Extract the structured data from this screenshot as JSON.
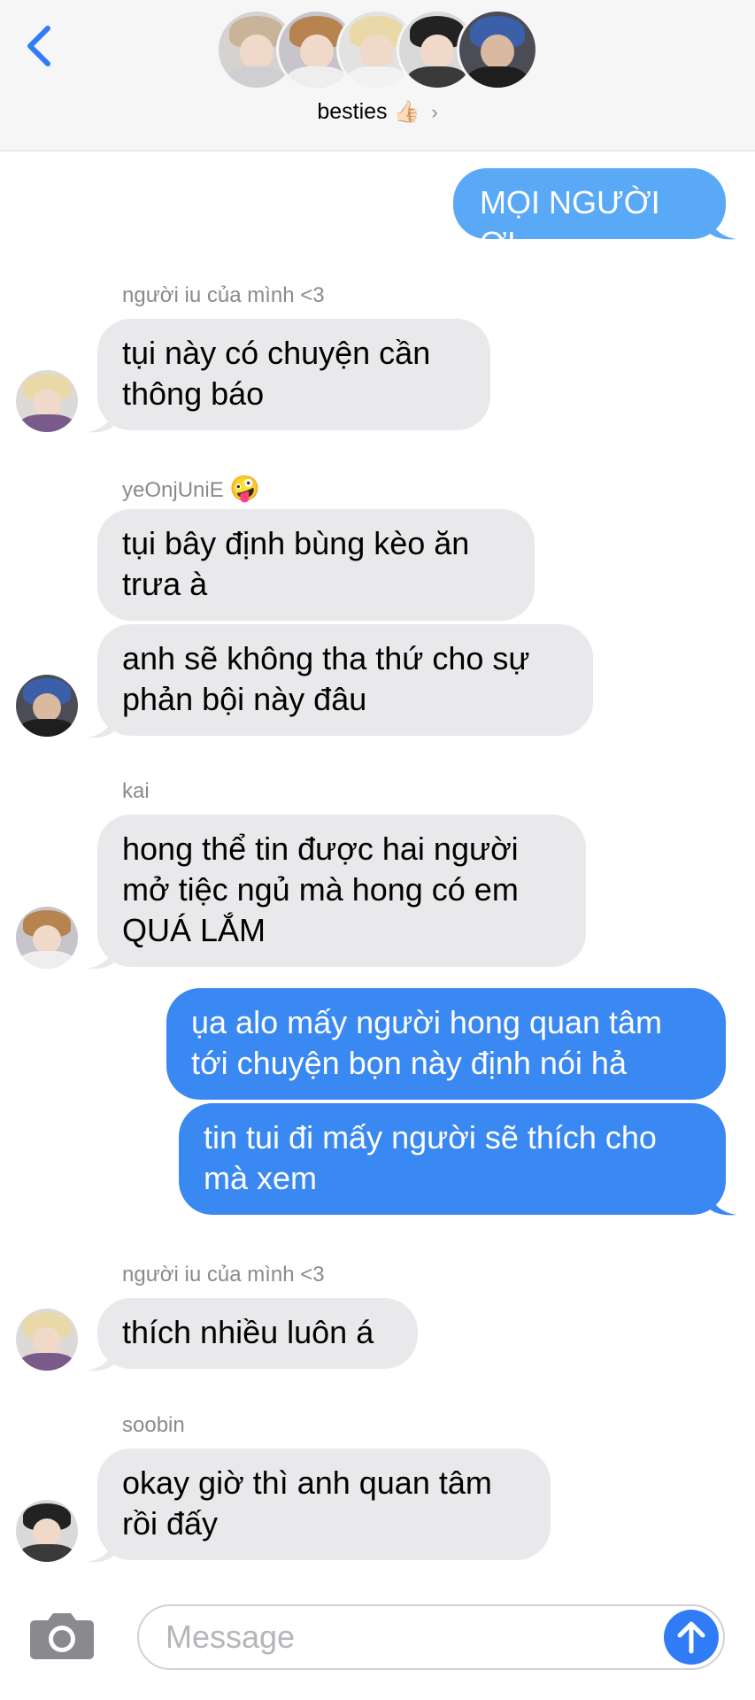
{
  "header": {
    "group_name": "besties",
    "group_emoji": "👍🏻",
    "chevron": "›"
  },
  "messages": [
    {
      "id": "m1",
      "direction": "outgoing",
      "text": "MỌI NGƯỜI ƠI"
    },
    {
      "id": "m2",
      "direction": "incoming",
      "sender": "người iu của mình <3",
      "text": "tụi này có chuyện cần thông báo"
    },
    {
      "id": "m3",
      "direction": "incoming",
      "sender": "yeOnjUniE",
      "sender_emoji": "🤪",
      "text": "tụi bây định bùng kèo ăn trưa à"
    },
    {
      "id": "m4",
      "direction": "incoming",
      "text": "anh sẽ không tha thứ cho sự phản bội này đâu"
    },
    {
      "id": "m5",
      "direction": "incoming",
      "sender": "kai",
      "text": "hong thể tin được hai người mở tiệc ngủ mà hong có em QUÁ LẮM"
    },
    {
      "id": "m6",
      "direction": "outgoing",
      "text": "ụa alo mấy người hong quan tâm tới chuyện bọn này định nói hả"
    },
    {
      "id": "m7",
      "direction": "outgoing",
      "text": "tin tui đi mấy người sẽ thích cho mà xem"
    },
    {
      "id": "m8",
      "direction": "incoming",
      "sender": "người iu của mình <3",
      "text": "thích nhiều luôn á"
    },
    {
      "id": "m9",
      "direction": "incoming",
      "sender": "soobin",
      "text": "okay giờ thì anh quan tâm rồi đấy"
    }
  ],
  "compose": {
    "placeholder": "Message"
  },
  "colors": {
    "outgoing_bubble": "#3a88f2",
    "outgoing_bubble_light": "#5aa9f7",
    "incoming_bubble": "#e9e9eb",
    "accent": "#2f7cf6"
  }
}
